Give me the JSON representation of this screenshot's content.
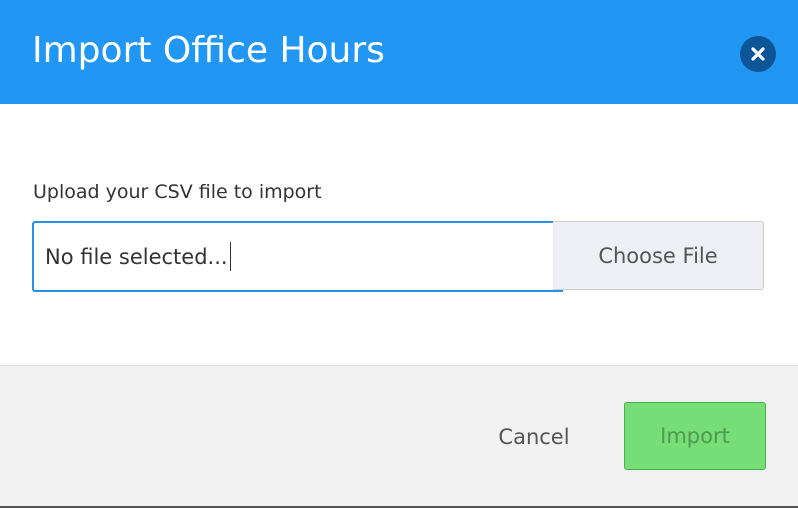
{
  "modal": {
    "title": "Import Office Hours",
    "close_icon": "close-icon",
    "colors": {
      "header_background": "#2196f3",
      "close_button_background": "#0c5697",
      "input_focus_border": "#2a8fe6",
      "import_button_background": "#77dd77"
    }
  },
  "upload": {
    "label": "Upload your CSV file to import",
    "file_status": "No file selected...",
    "choose_file_label": "Choose File"
  },
  "footer": {
    "cancel_label": "Cancel",
    "import_label": "Import"
  }
}
